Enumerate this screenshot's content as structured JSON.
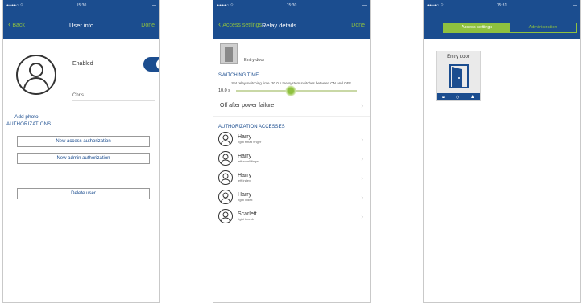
{
  "screen1": {
    "status_center": "15:30",
    "back_label": "Back",
    "title": "User info",
    "done_label": "Done",
    "enabled_label": "Enabled",
    "name_value": "Chris",
    "add_photo_label": "Add photo",
    "section_header": "AUTHORIZATIONS",
    "buttons": [
      {
        "label": "New access authorization"
      },
      {
        "label": "New admin authorization"
      },
      {
        "label": "Delete user"
      }
    ],
    "accent_color": "#8fc13f",
    "nav_color": "#1b4d8f"
  },
  "screen2": {
    "status_center": "15:30",
    "back_label": "Access settings",
    "title": "Relay details",
    "done_label": "Done",
    "door_name": "Entry door",
    "switching_header": "SWITCHING TIME",
    "switching_desc": "Set relay switching time. 30.0 s the system switches between ON and OFF.",
    "slider_value": "10.0 s",
    "slider_fraction": 0.45,
    "off_after_label": "Off after power failure",
    "auth_header": "AUTHORIZATION ACCESSES",
    "accesses": [
      {
        "name": "Harry",
        "sub": "right small finger"
      },
      {
        "name": "Harry",
        "sub": "left small finger"
      },
      {
        "name": "Harry",
        "sub": "left index"
      },
      {
        "name": "Harry",
        "sub": "right index"
      },
      {
        "name": "Scarlett",
        "sub": "right thumb"
      }
    ]
  },
  "screen3": {
    "status_center": "15:31",
    "seg_access": "Access settings",
    "seg_admin": "Administration",
    "door_card_name": "Entry door"
  }
}
